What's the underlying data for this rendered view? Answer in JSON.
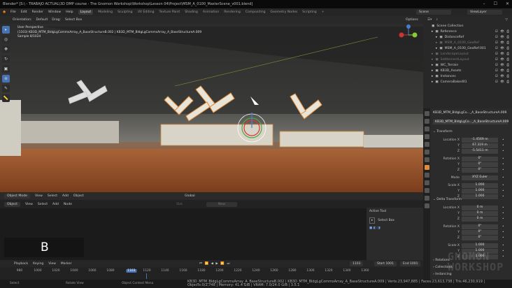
{
  "window": {
    "title": "Blender* [S:\\ - TRABAJO ACTUAL\\3D DMP course - The Gnomon Workshop\\Workshop\\Lesson 04\\Project\\MSM_A_0100_MasterScene_v001.blend]",
    "controls": [
      "–",
      "☐",
      "✕"
    ]
  },
  "menu": {
    "items": [
      "File",
      "Edit",
      "Render",
      "Window",
      "Help"
    ],
    "workspaces": [
      "Layout",
      "Modeling",
      "Sculpting",
      "UV Editing",
      "Texture Paint",
      "Shading",
      "Animation",
      "Rendering",
      "Compositing",
      "Geometry Nodes",
      "Scripting",
      "+"
    ],
    "scene": "Scene",
    "view_layer": "ViewLayer"
  },
  "viewport": {
    "orientation_label": "Orientation:",
    "orientation": "Default",
    "drag_label": "Drag:",
    "drag": "Select Box",
    "options": "Options",
    "info": [
      "User Perspective",
      "(1103) KB3D_MTM_BldgLgCommsArray_A_BaseStructureB.002 | KB3D_MTM_BldgLgCommsArray_A_BaseStructureA.009",
      "Sample 8/1024"
    ],
    "toolbar": [
      "cursor",
      "select",
      "move",
      "rotate",
      "scale",
      "transform",
      "annotate",
      "measure"
    ]
  },
  "viewport_footer": {
    "mode": "Object Mode",
    "menus": [
      "View",
      "Select",
      "Add",
      "Object"
    ],
    "transform": "Global"
  },
  "node_editor": {
    "type": "Object",
    "menus": [
      "View",
      "Select",
      "Add",
      "Node"
    ],
    "slot": "Slot",
    "new": "New",
    "label": "B"
  },
  "active_tool": {
    "title": "Active Tool",
    "tool": "Select Box"
  },
  "timeline": {
    "menus": [
      "Playback",
      "Keying",
      "View",
      "Marker"
    ],
    "current_frame": "1103",
    "start_label": "Start",
    "start": "1001",
    "end_label": "End",
    "end": "1001",
    "ticks": [
      "980",
      "1000",
      "1020",
      "1040",
      "1060",
      "1080",
      "1103",
      "1120",
      "1140",
      "1160",
      "1180",
      "1200",
      "1220",
      "1240",
      "1260",
      "1280",
      "1300",
      "1320",
      "1340",
      "1360"
    ]
  },
  "status": {
    "select": "Select",
    "rotate": "Rotate View",
    "context": "Object Context Menu",
    "stats": "KB3D_MTM_BldgLgCommsArray_A_BaseStructureB.002 | KB3D_MTM_BldgLgCommsArray_A_BaseStructureA.009 | Verts:23,947,885 | Faces:23,613,738 | Tris:46,230,919 | Objects:0/2,748 | Memory: 41.4 GiB | VRAM: 7.0/24.0 GiB | 3.5.1"
  },
  "outliner": {
    "root": "Scene Collection",
    "items": [
      {
        "label": "Reference",
        "indent": 1,
        "dim": false
      },
      {
        "label": "DistanceRef",
        "indent": 2,
        "dim": false
      },
      {
        "label": "MSM_A_0100_GeoRef",
        "indent": 2,
        "dim": true
      },
      {
        "label": "MSM_A_0100_GeoRef.001",
        "indent": 2,
        "dim": false
      },
      {
        "label": "LandscapeLayout",
        "indent": 1,
        "dim": true
      },
      {
        "label": "SettlementLayout",
        "indent": 1,
        "dim": true
      },
      {
        "label": "WC_Terrain",
        "indent": 1,
        "dim": false
      },
      {
        "label": "KB3D_Assets",
        "indent": 1,
        "dim": false
      },
      {
        "label": "Instances",
        "indent": 1,
        "dim": false
      },
      {
        "label": "CameraBaked01",
        "indent": 1,
        "dim": false
      }
    ]
  },
  "properties": {
    "object": "KB3D_MTM_BldgLgCo..._A_BaseStructureA.009",
    "object2": "KB3D_MTM_BldgLgCo..._A_BaseStructureA.009",
    "transform_title": "Transform",
    "transform": [
      {
        "label": "Location X",
        "value": "-1.4569 m"
      },
      {
        "label": "Y",
        "value": "67.319 m"
      },
      {
        "label": "Z",
        "value": "-5.5411 m"
      },
      {
        "label": "Rotation X",
        "value": "0°"
      },
      {
        "label": "Y",
        "value": "0°"
      },
      {
        "label": "Z",
        "value": "0°"
      },
      {
        "label": "Mode",
        "value": "XYZ Euler"
      },
      {
        "label": "Scale X",
        "value": "1.000"
      },
      {
        "label": "Y",
        "value": "1.000"
      },
      {
        "label": "Z",
        "value": "1.000"
      }
    ],
    "delta_title": "Delta Transform",
    "delta": [
      {
        "label": "Location X",
        "value": "0 m"
      },
      {
        "label": "Y",
        "value": "0 m"
      },
      {
        "label": "Z",
        "value": "0 m"
      },
      {
        "label": "Rotation X",
        "value": "0°"
      },
      {
        "label": "Y",
        "value": "0°"
      },
      {
        "label": "Z",
        "value": "0°"
      },
      {
        "label": "Scale X",
        "value": "1.000"
      },
      {
        "label": "Y",
        "value": "1.000"
      },
      {
        "label": "Z",
        "value": "1.000"
      }
    ],
    "sections": [
      "Relations",
      "Collections",
      "Instancing"
    ]
  },
  "watermark": "GNOMON WORKSHOP",
  "colors": {
    "accent": "#4772b3",
    "selection": "#e08b3a",
    "ground": "#a0522d"
  }
}
